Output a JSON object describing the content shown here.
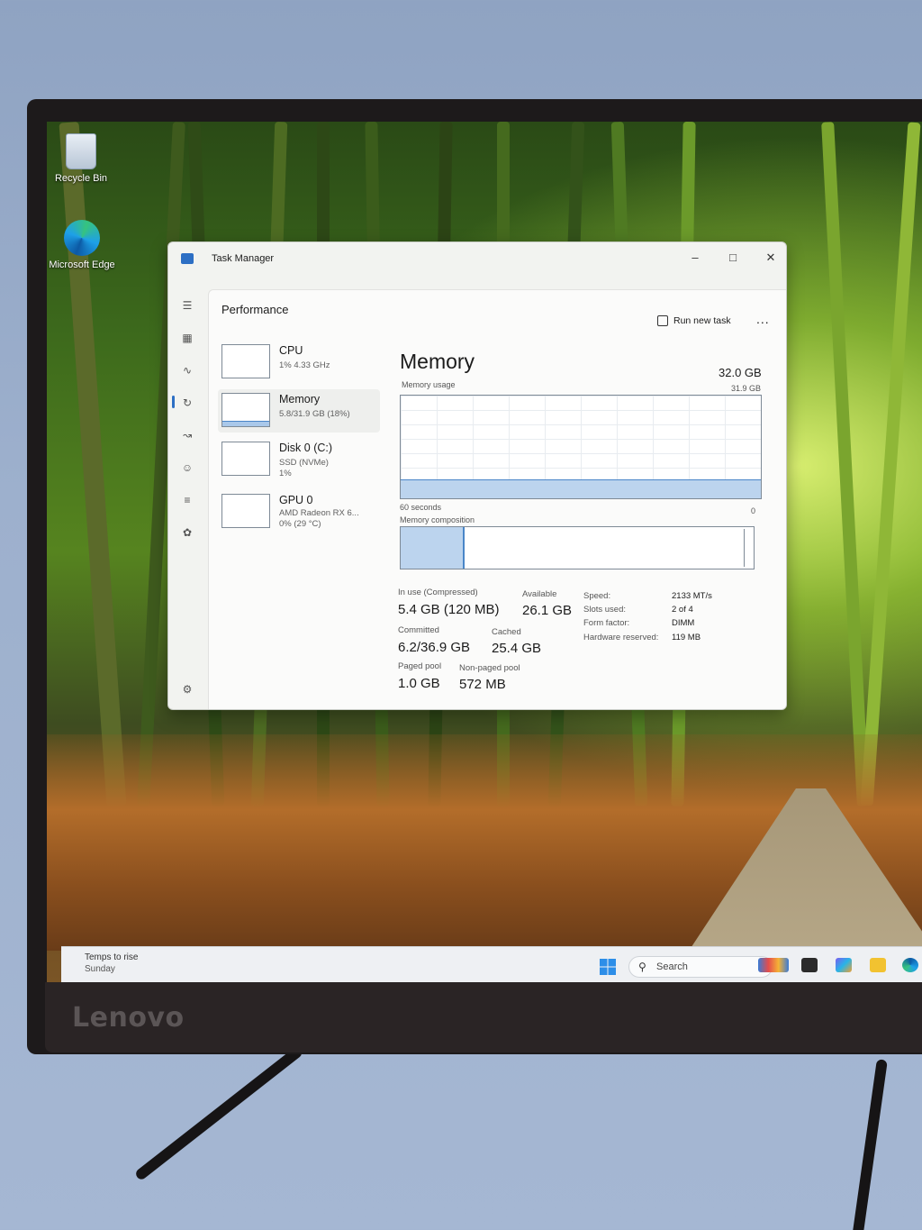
{
  "monitor": {
    "brand": "Lenovo"
  },
  "desktop": {
    "icons": [
      {
        "label": "Recycle Bin"
      },
      {
        "label": "Microsoft Edge"
      }
    ]
  },
  "task_manager": {
    "title": "Task Manager",
    "page_title": "Performance",
    "run_new_task": "Run new task",
    "more": "...",
    "devices": [
      {
        "name": "CPU",
        "line1": "1% 4.33 GHz",
        "line2": ""
      },
      {
        "name": "Memory",
        "line1": "5.8/31.9 GB (18%)",
        "line2": ""
      },
      {
        "name": "Disk 0 (C:)",
        "line1": "SSD (NVMe)",
        "line2": "1%"
      },
      {
        "name": "GPU 0",
        "line1": "AMD Radeon RX 6...",
        "line2": "0% (29 °C)"
      }
    ],
    "memory": {
      "heading": "Memory",
      "total": "32.0 GB",
      "usage_label": "Memory usage",
      "graph_max": "31.9 GB",
      "graph_time": "60 seconds",
      "graph_min": "0",
      "usage_fraction": 0.18,
      "composition_label": "Memory composition",
      "stats": {
        "in_use_label": "In use (Compressed)",
        "in_use_value": "5.4 GB (120 MB)",
        "available_label": "Available",
        "available_value": "26.1 GB",
        "committed_label": "Committed",
        "committed_value": "6.2/36.9 GB",
        "cached_label": "Cached",
        "cached_value": "25.4 GB",
        "paged_label": "Paged pool",
        "paged_value": "1.0 GB",
        "nonpaged_label": "Non-paged pool",
        "nonpaged_value": "572 MB"
      },
      "specs": [
        {
          "label": "Speed:",
          "value": "2133 MT/s"
        },
        {
          "label": "Slots used:",
          "value": "2 of 4"
        },
        {
          "label": "Form factor:",
          "value": "DIMM"
        },
        {
          "label": "Hardware reserved:",
          "value": "119 MB"
        }
      ]
    }
  },
  "taskbar": {
    "weather_line1": "Temps to rise",
    "weather_line2": "Sunday",
    "search_placeholder": "Search"
  }
}
